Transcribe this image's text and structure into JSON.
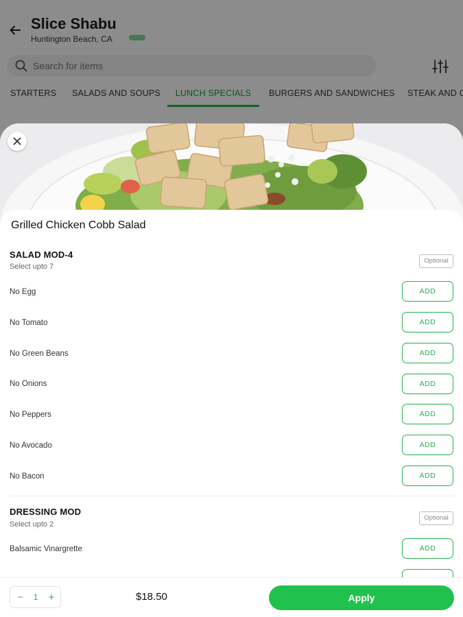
{
  "store": {
    "name": "Slice Shabu",
    "location": "Huntington Beach, CA"
  },
  "search": {
    "placeholder": "Search for items"
  },
  "tabs": [
    {
      "label": "STARTERS",
      "active": false
    },
    {
      "label": "SALADS AND SOUPS",
      "active": false
    },
    {
      "label": "LUNCH SPECIALS",
      "active": true
    },
    {
      "label": "BURGERS AND SANDWICHES",
      "active": false
    },
    {
      "label": "STEAK AND C",
      "active": false
    }
  ],
  "item": {
    "title": "Grilled Chicken Cobb Salad",
    "image": "grilled-chicken-cobb-salad-photo"
  },
  "groups": [
    {
      "title": "SALAD MOD-4",
      "subtitle": "Select upto 7",
      "badge": "Optional",
      "options": [
        {
          "label": "No Egg",
          "button": "ADD"
        },
        {
          "label": "No Tomato",
          "button": "ADD"
        },
        {
          "label": "No Green Beans",
          "button": "ADD"
        },
        {
          "label": "No Onions",
          "button": "ADD"
        },
        {
          "label": "No Peppers",
          "button": "ADD"
        },
        {
          "label": "No Avocado",
          "button": "ADD"
        },
        {
          "label": "No Bacon",
          "button": "ADD"
        }
      ]
    },
    {
      "title": "DRESSING MOD",
      "subtitle": "Select upto 2",
      "badge": "Optional",
      "options": [
        {
          "label": "Balsamic Vinargrette",
          "button": "ADD"
        }
      ]
    }
  ],
  "footer": {
    "quantity": "1",
    "minus": "−",
    "plus": "+",
    "price": "$18.50",
    "apply_label": "Apply"
  },
  "colors": {
    "accent": "#21b24b",
    "apply": "#21c14d",
    "active_tab": "#179c3e"
  },
  "icons": {
    "back": "arrow-left-icon",
    "search": "search-icon",
    "filter": "sliders-icon",
    "close": "close-icon"
  }
}
